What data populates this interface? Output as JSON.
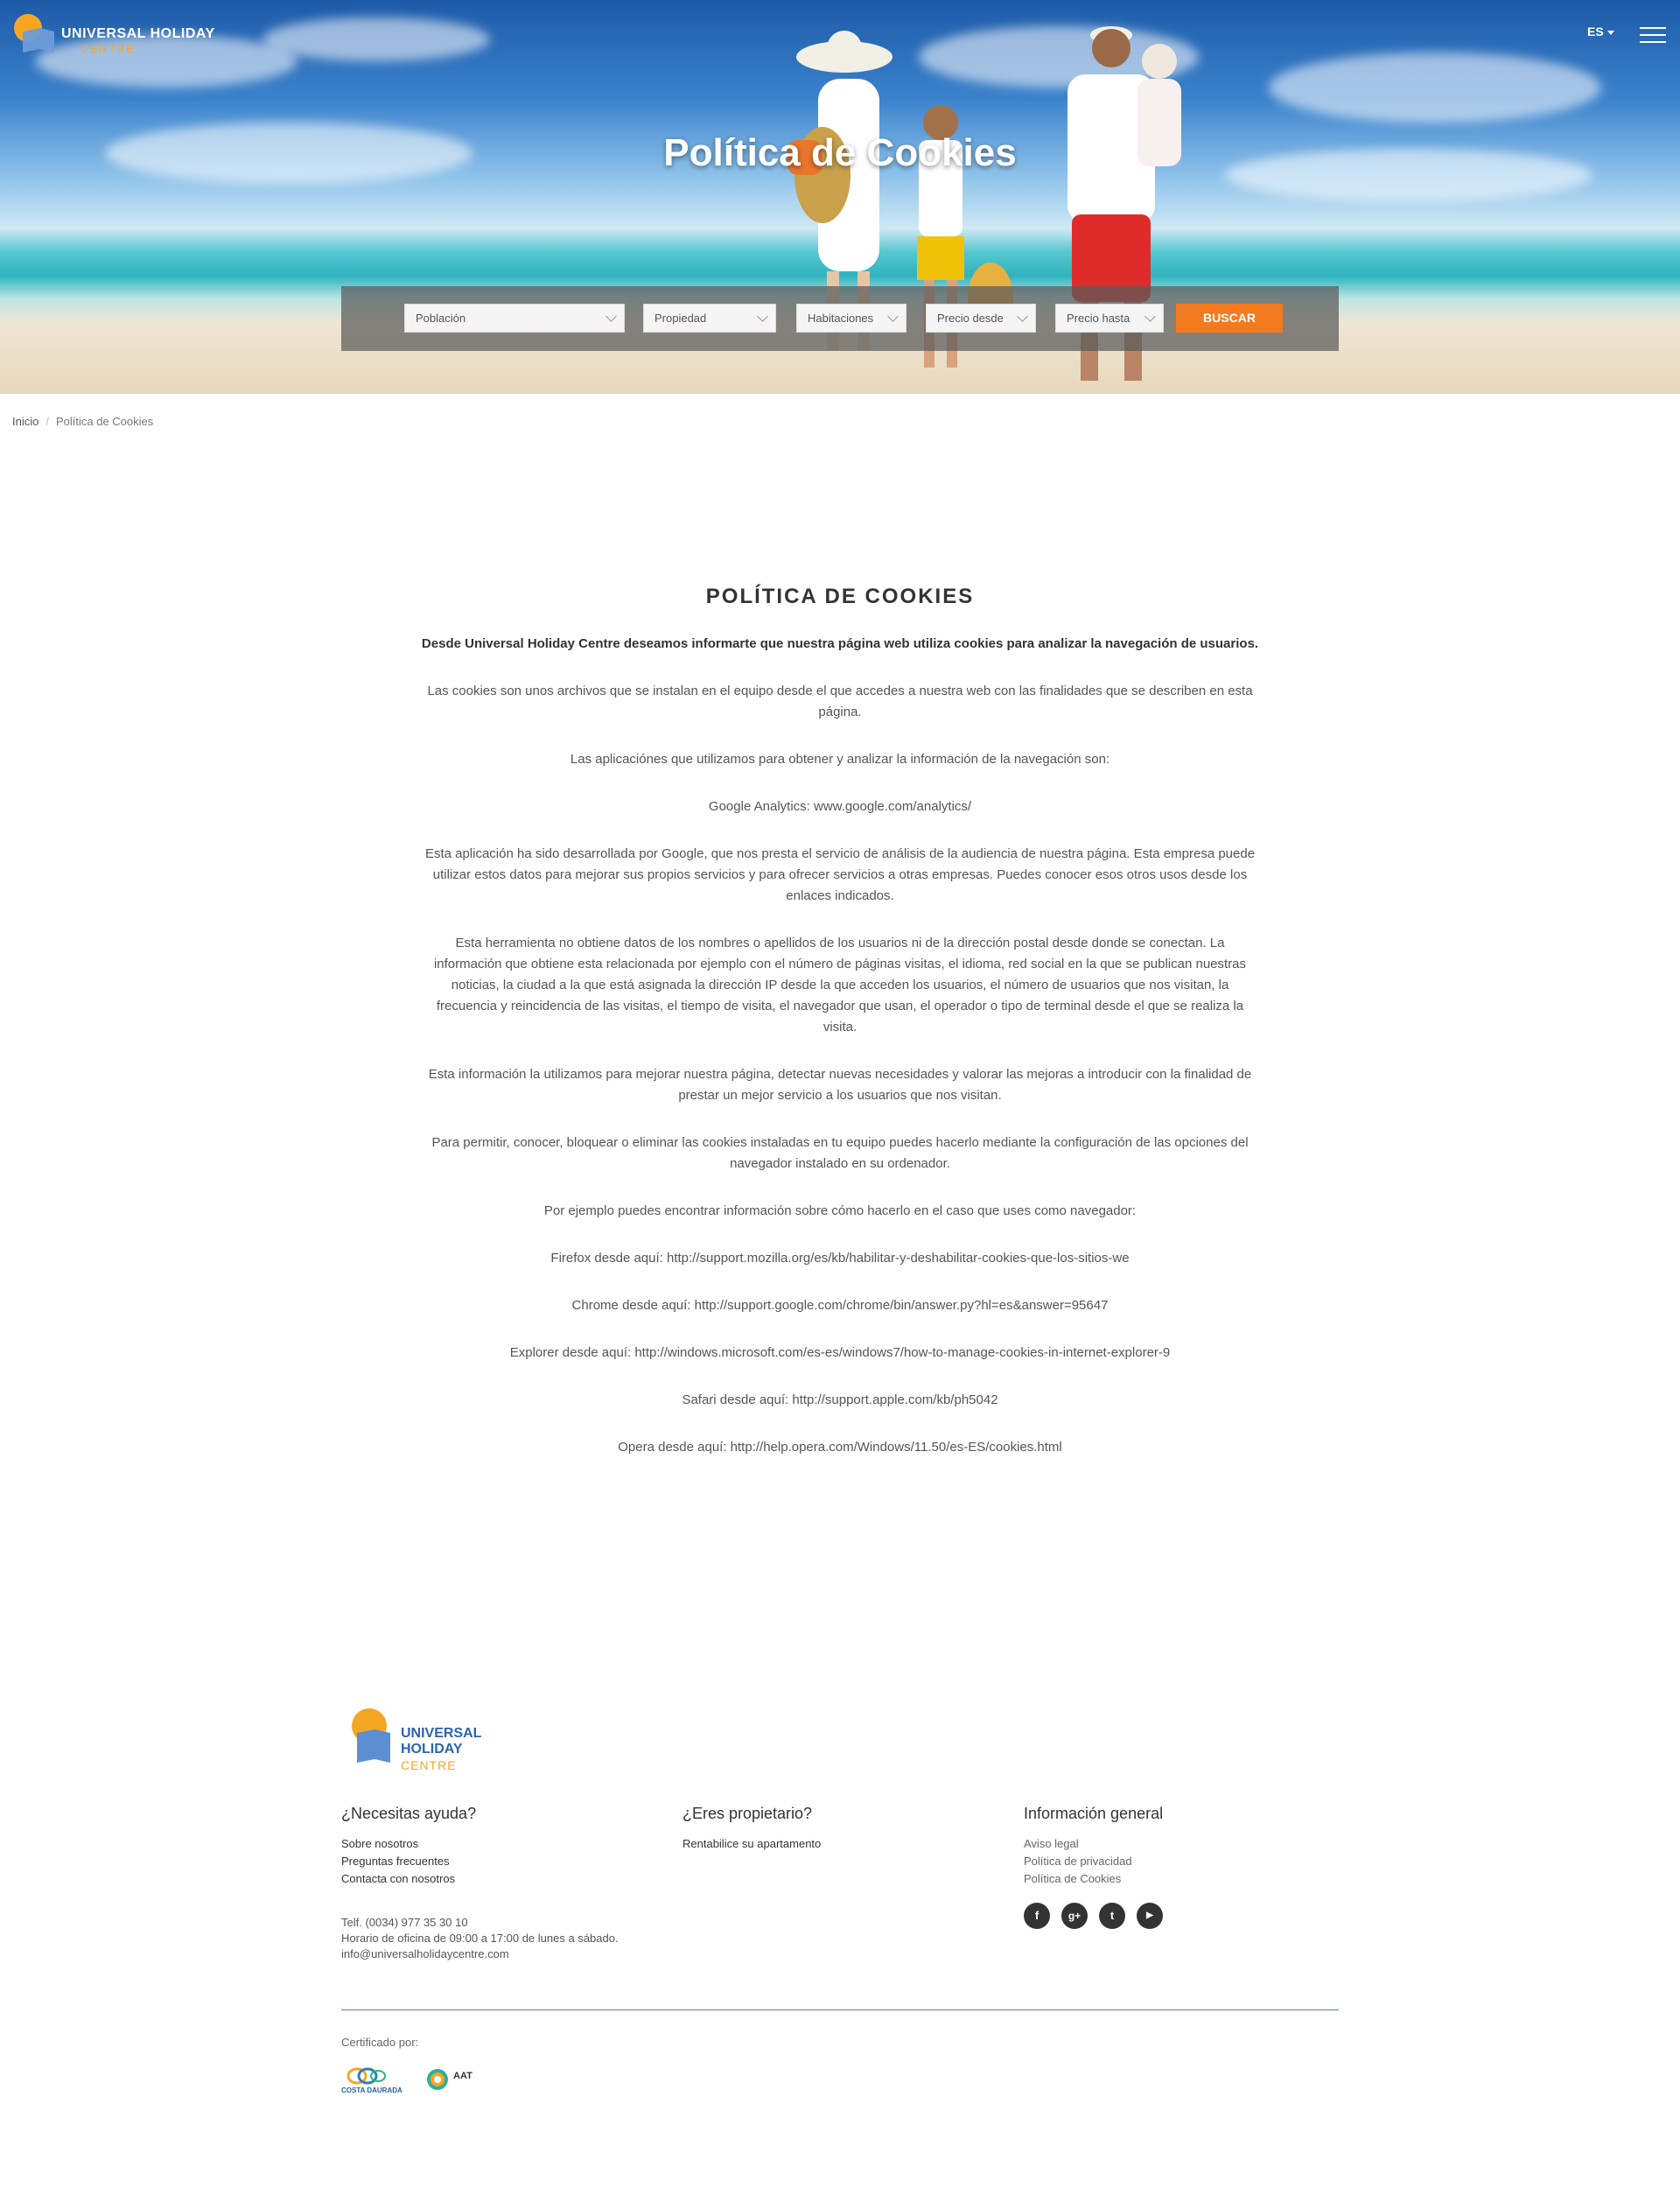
{
  "header": {
    "logo_line1": "UNIVERSAL HOLIDAY",
    "logo_line2": "CENTRE",
    "language": "ES",
    "menu_icon": "hamburger-icon",
    "title": "Política de Cookies"
  },
  "search": {
    "poblacion": "Población",
    "propiedad": "Propiedad",
    "habitaciones": "Habitaciones",
    "precio_desde": "Precio desde",
    "precio_hasta": "Precio hasta",
    "button": "BUSCAR"
  },
  "breadcrumb": {
    "home": "Inicio",
    "separator": "/",
    "current": "Política de Cookies"
  },
  "content": {
    "heading": "POLÍTICA DE COOKIES",
    "paragraphs": [
      "Desde Universal Holiday Centre deseamos informarte que nuestra página web utiliza cookies para analizar la navegación de usuarios.",
      "Las cookies son unos archivos que se instalan en el equipo desde el que accedes a nuestra web con las finalidades que se describen en esta página.",
      "Las aplicaciónes que utilizamos para obtener y analizar la información de la navegación son:",
      "Google Analytics: www.google.com/analytics/",
      "Esta aplicación ha sido desarrollada por Google, que nos presta el servicio de análisis de la audiencia de nuestra página. Esta empresa puede utilizar estos datos para mejorar sus propios servicios y para ofrecer servicios a otras empresas. Puedes conocer esos otros usos desde los enlaces indicados.",
      "Esta herramienta no obtiene datos de los nombres o apellidos de los usuarios ni de la dirección postal desde donde se conectan. La información que obtiene esta relacionada por ejemplo con el número de páginas visitas, el idioma, red social en la que se publican nuestras noticias, la ciudad a la que está asignada la dirección IP desde la que acceden los usuarios, el número de usuarios que nos visitan, la frecuencia y reincidencia de las visitas, el tiempo de visita, el navegador que usan, el operador o tipo de terminal desde el que se realiza la visita.",
      "Esta información la utilizamos para mejorar nuestra página, detectar nuevas necesidades y valorar las mejoras a introducir con la finalidad de prestar un mejor servicio a los usuarios que nos visitan.",
      "Para permitir, conocer, bloquear o eliminar las cookies instaladas en tu equipo puedes hacerlo mediante la configuración de las opciones del navegador instalado en su ordenador.",
      "Por ejemplo puedes encontrar información sobre cómo hacerlo en el caso que uses como navegador:",
      "Firefox desde aquí: http://support.mozilla.org/es/kb/habilitar-y-deshabilitar-cookies-que-los-sitios-we",
      "Chrome desde aquí: http://support.google.com/chrome/bin/answer.py?hl=es&answer=95647",
      "Explorer desde aquí: http://windows.microsoft.com/es-es/windows7/how-to-manage-cookies-in-internet-explorer-9",
      "Safari desde aquí: http://support.apple.com/kb/ph5042",
      "Opera desde aquí: http://help.opera.com/Windows/11.50/es-ES/cookies.html"
    ]
  },
  "footer": {
    "logo_line1": "UNIVERSAL",
    "logo_line2": "HOLIDAY",
    "logo_line3": "CENTRE",
    "col1": {
      "title": "¿Necesitas ayuda?",
      "links": [
        "Sobre nosotros",
        "Preguntas frecuentes",
        "Contacta con nosotros"
      ]
    },
    "col2": {
      "title": "¿Eres propietario?",
      "links": [
        "Rentabilice su apartamento"
      ]
    },
    "col3": {
      "title": "Información general",
      "links": [
        "Aviso legal",
        "Política de privacidad",
        "Política de Cookies"
      ]
    },
    "contact": {
      "phone": "Telf. (0034) 977 35 30 10",
      "hours": "Horario de oficina de 09:00 a 17:00 de lunes a sábado.",
      "email": "info@universalholidaycentre.com"
    },
    "social": {
      "facebook": "f",
      "googleplus": "g+",
      "twitter": "t",
      "youtube": "▶"
    },
    "cert_label": "Certificado por:",
    "cert1": "COSTA DAURADA",
    "cert2": "AAT"
  },
  "colors": {
    "accent": "#f47a1f",
    "logo_orange": "#f4a623",
    "logo_blue": "#5b8fd1",
    "divider": "#4a7fb0"
  }
}
